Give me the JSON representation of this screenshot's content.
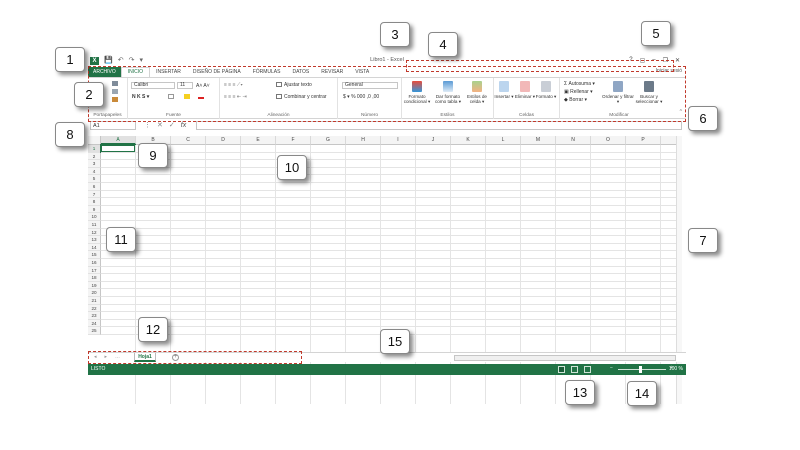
{
  "window": {
    "title": "Libro1 - Excel",
    "logo_text": "X",
    "qat": [
      "💾",
      "↶",
      "↷",
      "▾"
    ],
    "controls": [
      "?",
      "▢",
      "–",
      "❐",
      "✕"
    ]
  },
  "tabs": [
    "ARCHIVO",
    "INICIO",
    "INSERTAR",
    "DISEÑO DE PÁGINA",
    "FÓRMULAS",
    "DATOS",
    "REVISAR",
    "VISTA"
  ],
  "signin": "Iniciar sesió",
  "ribbon": {
    "groups": [
      "Portapapeles",
      "Fuente",
      "Alineación",
      "Número",
      "Estilos",
      "Celdas",
      "Modificar"
    ],
    "font_name": "Calibri",
    "font_size": "11",
    "font_buttons": "N  K  S  ▾",
    "wrap_text": "Ajustar texto",
    "merge_center": "Combinar y centrar",
    "number_format": "General",
    "number_buttons": "$ ▾ %  000  ,0  ,00",
    "styles": [
      "Formato condicional ▾",
      "Dar formato como tabla ▾",
      "Estilos de celda ▾"
    ],
    "cells": [
      "Insertar ▾",
      "Eliminar ▾",
      "Formato ▾"
    ],
    "editing": [
      "Autosuma ▾",
      "Rellenar ▾",
      "Borrar ▾"
    ],
    "sort_filter": "Ordenar y filtrar ▾",
    "find_select": "Buscar y seleccionar ▾",
    "collapse": "^"
  },
  "formula_bar": {
    "namebox": "A1",
    "buttons": [
      "⋮",
      "✕",
      "✓",
      "fx"
    ]
  },
  "grid": {
    "columns": [
      "A",
      "B",
      "C",
      "D",
      "E",
      "F",
      "G",
      "H",
      "I",
      "J",
      "K",
      "L",
      "M",
      "N",
      "O",
      "P",
      "Q"
    ],
    "rows": [
      "1",
      "2",
      "3",
      "4",
      "5",
      "6",
      "7",
      "8",
      "9",
      "10",
      "11",
      "12",
      "13",
      "14",
      "15",
      "16",
      "17",
      "18",
      "19",
      "20",
      "21",
      "22",
      "23",
      "24",
      "25"
    ]
  },
  "sheets": {
    "nav": [
      "◂",
      "▸",
      "…"
    ],
    "active": "Hoja1",
    "add": "+"
  },
  "status": {
    "text": "LISTO",
    "zoom": "100 %",
    "zoom_minus": "−",
    "zoom_plus": "+"
  },
  "callouts": [
    "1",
    "2",
    "3",
    "4",
    "5",
    "6",
    "7",
    "8",
    "9",
    "10",
    "11",
    "12",
    "13",
    "14",
    "15"
  ],
  "colors": {
    "accent": "#217346",
    "callout_border": "#c0392b"
  }
}
